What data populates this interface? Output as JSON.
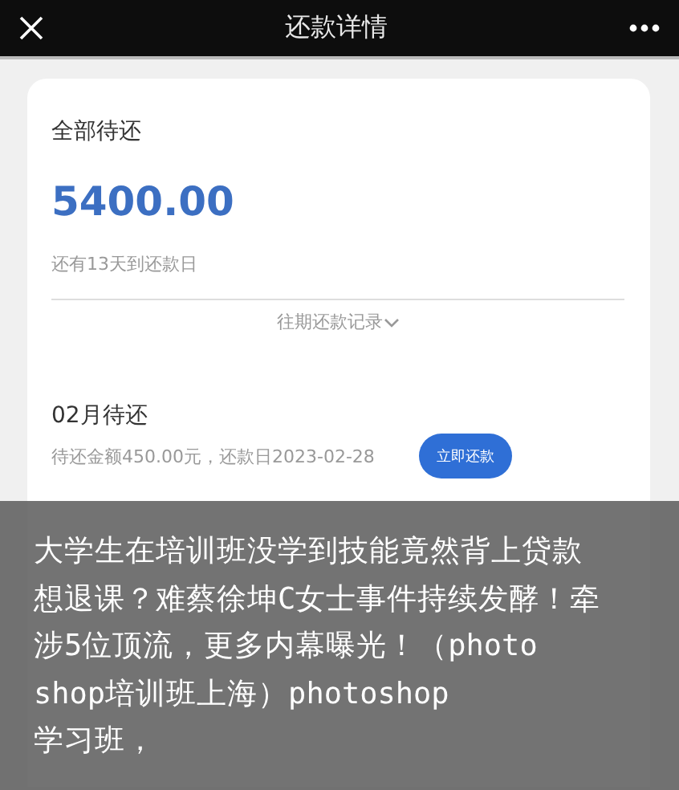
{
  "header": {
    "title": "还款详情"
  },
  "summary": {
    "label": "全部待还",
    "amount": "5400.00",
    "countdown": "还有13天到还款日",
    "history_link": "往期还款记录"
  },
  "installments": [
    {
      "title": "02月待还",
      "detail": "待还金额450.00元，还款日2023-02-28",
      "button": "立即还款"
    }
  ],
  "caption": {
    "lines": [
      "大学生在培训班没学到技能竟然背上贷款",
      "想退课？难蔡徐坤C女士事件持续发酵！牵",
      "涉5位顶流，更多内幕曝光！（photo",
      "shop培训班上海）photoshop",
      "学习班，"
    ]
  }
}
